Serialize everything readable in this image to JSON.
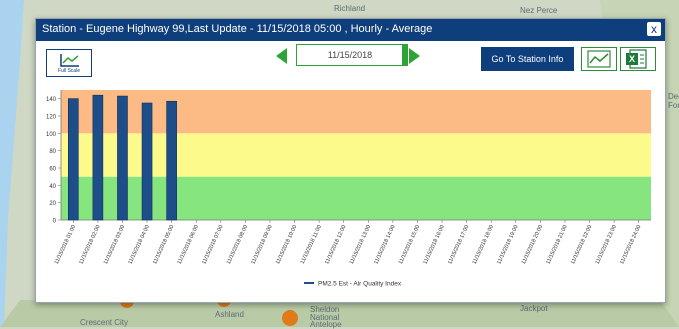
{
  "dialog": {
    "title": "Station - Eugene Highway 99,Last Update - 11/15/2018 05:00 , Hourly - Average",
    "close_label": "x"
  },
  "toolbar": {
    "full_scale_label": "Full Scale",
    "date_value": "11/15/2018",
    "station_button_label": "Go To Station Info",
    "chart_icon": "line-chart-image-icon",
    "excel_icon": "excel-icon"
  },
  "map_labels": [
    "Richland",
    "Nez Perce",
    "Deer",
    "Fore",
    "Sheldon",
    "National",
    "Antelope",
    "Crescent City",
    "Ashland",
    "Jackpot"
  ],
  "chart_data": {
    "type": "bar",
    "title": "",
    "xlabel": "",
    "ylabel": "",
    "ylim": [
      0,
      150
    ],
    "yticks": [
      0,
      20,
      40,
      60,
      80,
      100,
      120,
      140
    ],
    "categories": [
      "11/15/2018 01:00",
      "11/15/2018 02:00",
      "11/15/2018 03:00",
      "11/15/2018 04:00",
      "11/15/2018 05:00",
      "11/15/2018 06:00",
      "11/15/2018 07:00",
      "11/15/2018 08:00",
      "11/15/2018 09:00",
      "11/15/2018 10:00",
      "11/15/2018 11:00",
      "11/15/2018 12:00",
      "11/15/2018 13:00",
      "11/15/2018 14:00",
      "11/15/2018 15:00",
      "11/15/2018 16:00",
      "11/15/2018 17:00",
      "11/15/2018 18:00",
      "11/15/2018 19:00",
      "11/15/2018 20:00",
      "11/15/2018 21:00",
      "11/15/2018 22:00",
      "11/15/2018 23:00",
      "11/15/2018 24:00"
    ],
    "series": [
      {
        "name": "PM2.5 Est - Air Quality Index",
        "values": [
          140,
          144,
          143,
          135,
          137,
          null,
          null,
          null,
          null,
          null,
          null,
          null,
          null,
          null,
          null,
          null,
          null,
          null,
          null,
          null,
          null,
          null,
          null,
          null
        ]
      }
    ],
    "bands": [
      {
        "from": 0,
        "to": 50,
        "color": "#86e57e"
      },
      {
        "from": 50,
        "to": 100,
        "color": "#fdfa8c"
      },
      {
        "from": 100,
        "to": 150,
        "color": "#fcbb84"
      }
    ],
    "bar_color": "#1e4e8a",
    "legend_position": "bottom-center",
    "grid": false
  }
}
